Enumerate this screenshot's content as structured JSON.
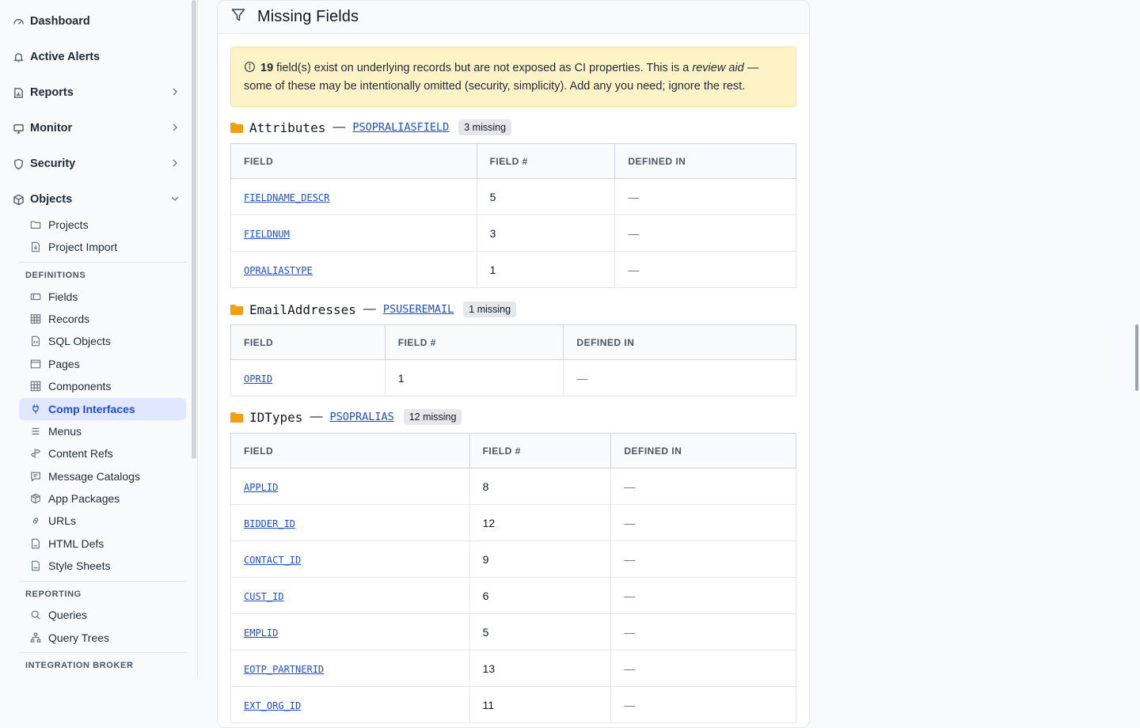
{
  "sidebar": {
    "top": [
      {
        "label": "Dashboard",
        "icon": "gauge-icon"
      },
      {
        "label": "Active Alerts",
        "icon": "bell-icon"
      },
      {
        "label": "Reports",
        "icon": "report-icon"
      },
      {
        "label": "Monitor",
        "icon": "monitor-icon"
      },
      {
        "label": "Security",
        "icon": "shield-icon"
      },
      {
        "label": "Objects",
        "icon": "cube-icon"
      }
    ],
    "objects_items": [
      "Projects",
      "Project Import"
    ],
    "definitions_label": "DEFINITIONS",
    "definitions": [
      "Fields",
      "Records",
      "SQL Objects",
      "Pages",
      "Components",
      "Comp Interfaces",
      "Menus",
      "Content Refs",
      "Message Catalogs",
      "App Packages",
      "URLs",
      "HTML Defs",
      "Style Sheets"
    ],
    "active_item": "Comp Interfaces",
    "reporting_label": "REPORTING",
    "reporting": [
      "Queries",
      "Query Trees"
    ],
    "integration_label": "INTEGRATION BROKER"
  },
  "panel": {
    "title": "Missing Fields",
    "notice": {
      "count": "19",
      "text1": " field(s) exist on underlying records but are not exposed as CI properties. This is a ",
      "emph": "review aid",
      "text2": " — some of these may be intentionally omitted (security, simplicity). Add any you need; ignore the rest."
    },
    "headers": {
      "field": "FIELD",
      "fieldnum": "FIELD #",
      "defined": "DEFINED IN"
    },
    "groups": [
      {
        "name": "Attributes",
        "record": "PSOPRALIASFIELD",
        "badge": "3 missing",
        "rows": [
          {
            "field": "FIELDNAME_DESCR",
            "num": "5",
            "defined": "—"
          },
          {
            "field": "FIELDNUM",
            "num": "3",
            "defined": "—"
          },
          {
            "field": "OPRALIASTYPE",
            "num": "1",
            "defined": "—"
          }
        ]
      },
      {
        "name": "EmailAddresses",
        "record": "PSUSEREMAIL",
        "badge": "1 missing",
        "rows": [
          {
            "field": "OPRID",
            "num": "1",
            "defined": "—"
          }
        ]
      },
      {
        "name": "IDTypes",
        "record": "PSOPRALIAS",
        "badge": "12 missing",
        "rows": [
          {
            "field": "APPLID",
            "num": "8",
            "defined": "—"
          },
          {
            "field": "BIDDER_ID",
            "num": "12",
            "defined": "—"
          },
          {
            "field": "CONTACT_ID",
            "num": "9",
            "defined": "—"
          },
          {
            "field": "CUST_ID",
            "num": "6",
            "defined": "—"
          },
          {
            "field": "EMPLID",
            "num": "5",
            "defined": "—"
          },
          {
            "field": "EOTP_PARTNERID",
            "num": "13",
            "defined": "—"
          },
          {
            "field": "EXT_ORG_ID",
            "num": "11",
            "defined": "—"
          }
        ]
      }
    ]
  }
}
